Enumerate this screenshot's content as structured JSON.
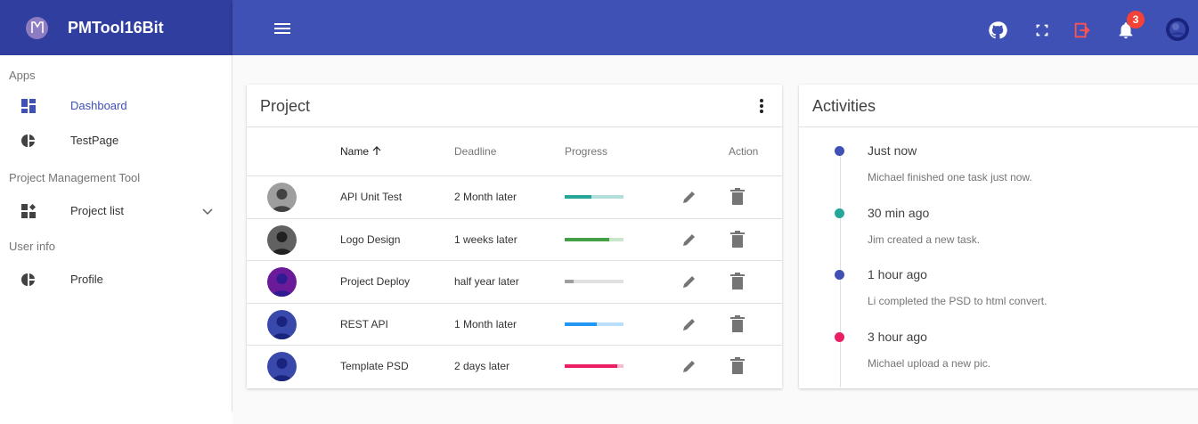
{
  "app": {
    "name": "PMTool16Bit"
  },
  "appbar": {
    "notification_count": "3"
  },
  "sidebar": {
    "sections": [
      {
        "title": "Apps"
      },
      {
        "title": "Project Management Tool"
      },
      {
        "title": "User info"
      }
    ],
    "items": [
      {
        "label": "Dashboard",
        "icon": "dashboard-icon"
      },
      {
        "label": "TestPage",
        "icon": "pie-chart-icon"
      },
      {
        "label": "Project list",
        "icon": "project-list-icon"
      },
      {
        "label": "Profile",
        "icon": "pie-chart-icon"
      }
    ]
  },
  "project": {
    "title": "Project",
    "columns": {
      "name": "Name",
      "deadline": "Deadline",
      "progress": "Progress",
      "action": "Action"
    },
    "rows": [
      {
        "name": "API Unit Test",
        "deadline": "2 Month later",
        "progress": 0.45,
        "color": "#26a69a",
        "track": "#b2dfdb"
      },
      {
        "name": "Logo Design",
        "deadline": "1 weeks later",
        "progress": 0.75,
        "color": "#43a047",
        "track": "#c8e6c9"
      },
      {
        "name": "Project Deploy",
        "deadline": "half year later",
        "progress": 0.15,
        "color": "#9e9e9e",
        "track": "#e0e0e0"
      },
      {
        "name": "REST API",
        "deadline": "1 Month later",
        "progress": 0.55,
        "color": "#2196f3",
        "track": "#bbdefb"
      },
      {
        "name": "Template PSD",
        "deadline": "2 days later",
        "progress": 0.9,
        "color": "#e91e63",
        "track": "#f8bbd0"
      }
    ]
  },
  "activities": {
    "title": "Activities",
    "items": [
      {
        "time": "Just now",
        "text": "Michael finished one task just now.",
        "color": "#3f51b5"
      },
      {
        "time": "30 min ago",
        "text": "Jim created a new task.",
        "color": "#26a69a"
      },
      {
        "time": "1 hour ago",
        "text": "Li completed the PSD to html convert.",
        "color": "#3f51b5"
      },
      {
        "time": "3 hour ago",
        "text": "Michael upload a new pic.",
        "color": "#e91e63"
      }
    ]
  }
}
